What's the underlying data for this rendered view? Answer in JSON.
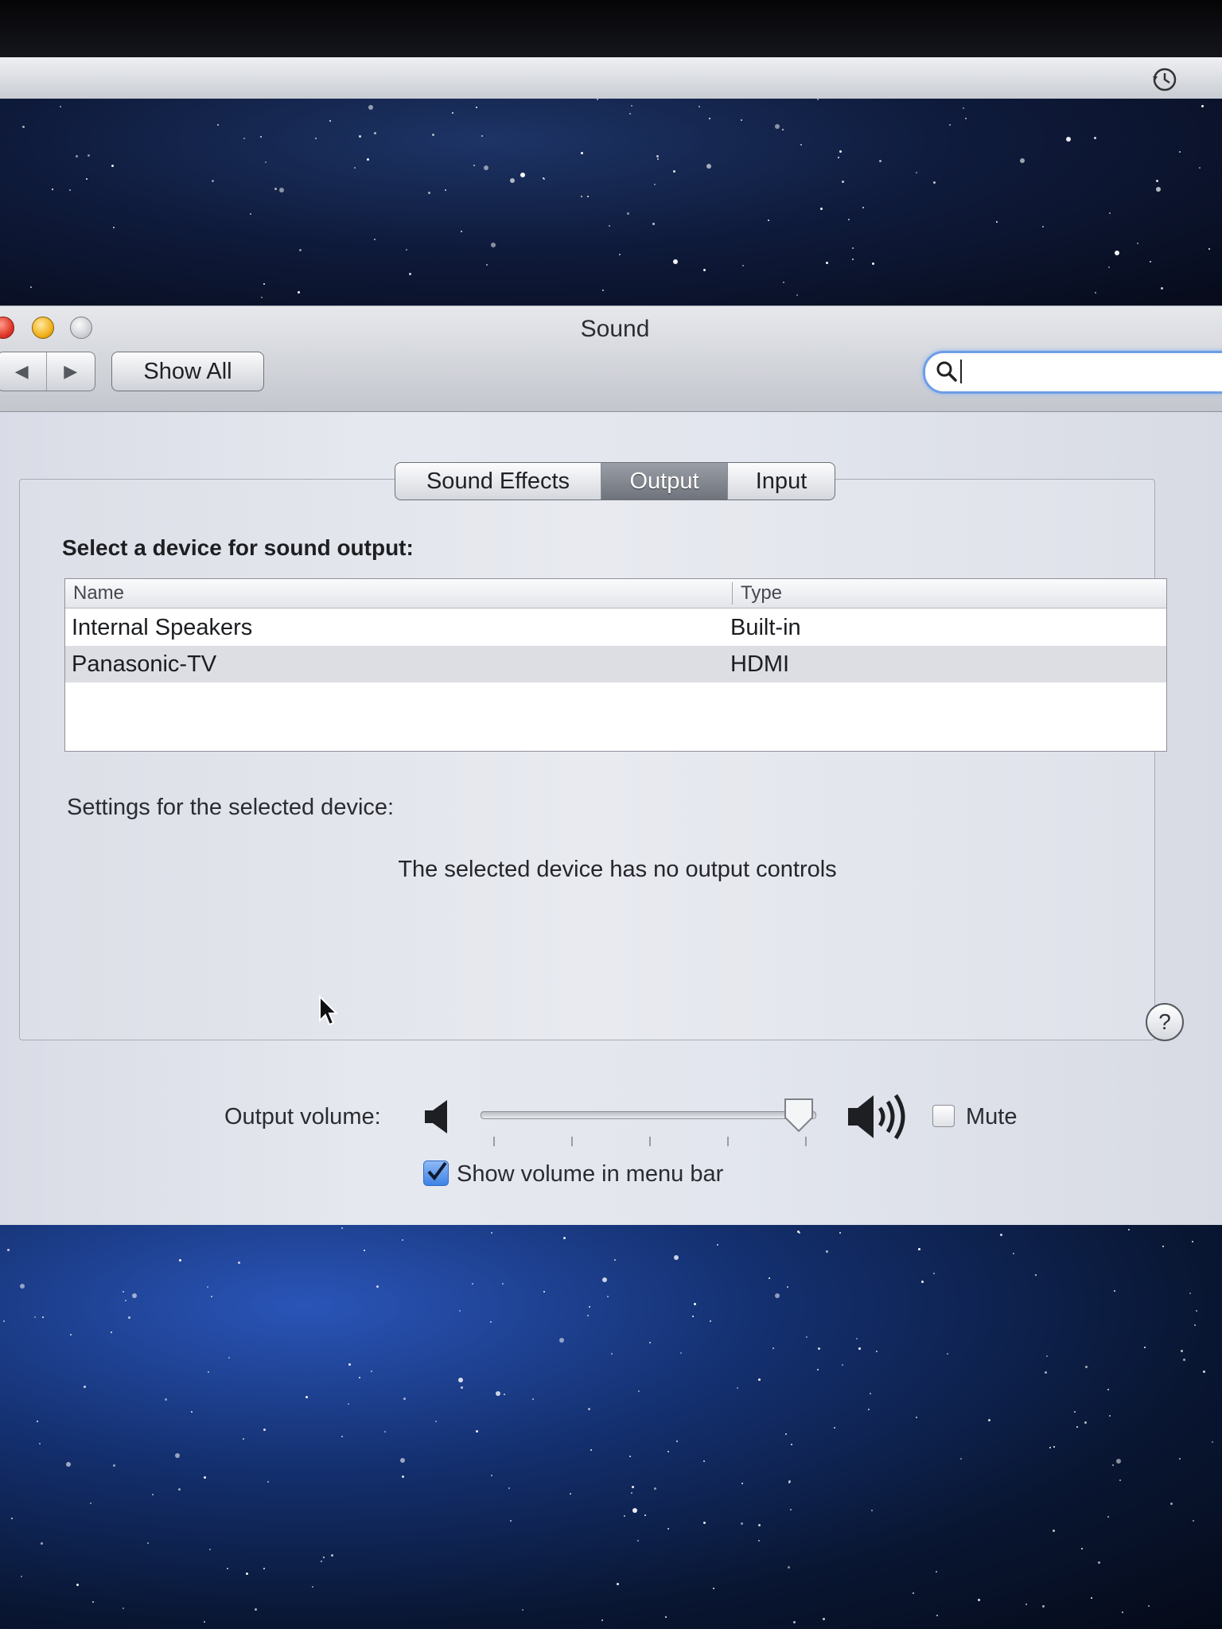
{
  "window": {
    "title": "Sound"
  },
  "toolbar": {
    "back_glyph": "◀",
    "forward_glyph": "▶",
    "show_all_label": "Show All",
    "search_placeholder": ""
  },
  "tabs": [
    {
      "label": "Sound Effects",
      "selected": false
    },
    {
      "label": "Output",
      "selected": true
    },
    {
      "label": "Input",
      "selected": false
    }
  ],
  "output": {
    "heading": "Select a device for sound output:",
    "columns": {
      "name": "Name",
      "type": "Type"
    },
    "devices": [
      {
        "name": "Internal Speakers",
        "type": "Built-in",
        "selected": false
      },
      {
        "name": "Panasonic-TV",
        "type": "HDMI",
        "selected": true
      }
    ],
    "settings_label": "Settings for the selected device:",
    "no_controls_message": "The selected device has no output controls",
    "help_glyph": "?"
  },
  "volume": {
    "label": "Output volume:",
    "level": 1.0,
    "mute_label": "Mute",
    "muted": false,
    "show_in_menu_bar_label": "Show volume in menu bar",
    "show_in_menu_bar": true
  },
  "icons": {
    "time_machine": "clock-history-icon",
    "search": "magnifier-icon",
    "speaker_low": "speaker-low-icon",
    "speaker_high": "speaker-high-icon"
  },
  "colors": {
    "selected_tab": "#7f838c",
    "focus_ring": "#6d9ee6",
    "selected_row": "#dcdee3"
  }
}
